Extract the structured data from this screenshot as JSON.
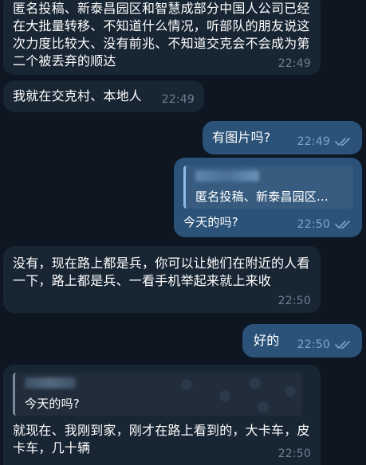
{
  "messages": [
    {
      "direction": "incoming",
      "text": "匿名投稿、新泰昌园区和智慧成部分中国人公司已经在大批量转移、不知道什么情况，听部队的朋友说这次力度比较大、没有前兆、不知道交克会不会成为第二个被丢弃的顺达",
      "time": "22:49"
    },
    {
      "direction": "incoming",
      "text": "我就在交克村、本地人",
      "time": "22:49"
    },
    {
      "direction": "outgoing",
      "text": "有图片吗?",
      "time": "22:49",
      "status": "read"
    },
    {
      "direction": "outgoing",
      "reply_preview": "匿名投稿、新泰昌园区...",
      "text": "今天的吗?",
      "time": "22:50",
      "status": "read"
    },
    {
      "direction": "incoming",
      "text": "没有，现在路上都是兵，你可以让她们在附近的人看一下，路上都是兵、一看手机举起来就上来收",
      "time": "22:50"
    },
    {
      "direction": "outgoing",
      "text": "好的",
      "time": "22:50",
      "status": "read"
    },
    {
      "direction": "incoming",
      "reply_preview": "今天的吗?",
      "text": "就现在、我刚到家，刚才在路上看到的，大卡车，皮卡车，几十辆",
      "time": "22:50"
    }
  ],
  "colors": {
    "background": "#0e1621",
    "incoming_bubble": "#182533",
    "outgoing_bubble": "#2b5278",
    "tick": "#7ea6c9"
  },
  "icons": [
    "double-check-icon",
    "pumpkin-icon"
  ]
}
